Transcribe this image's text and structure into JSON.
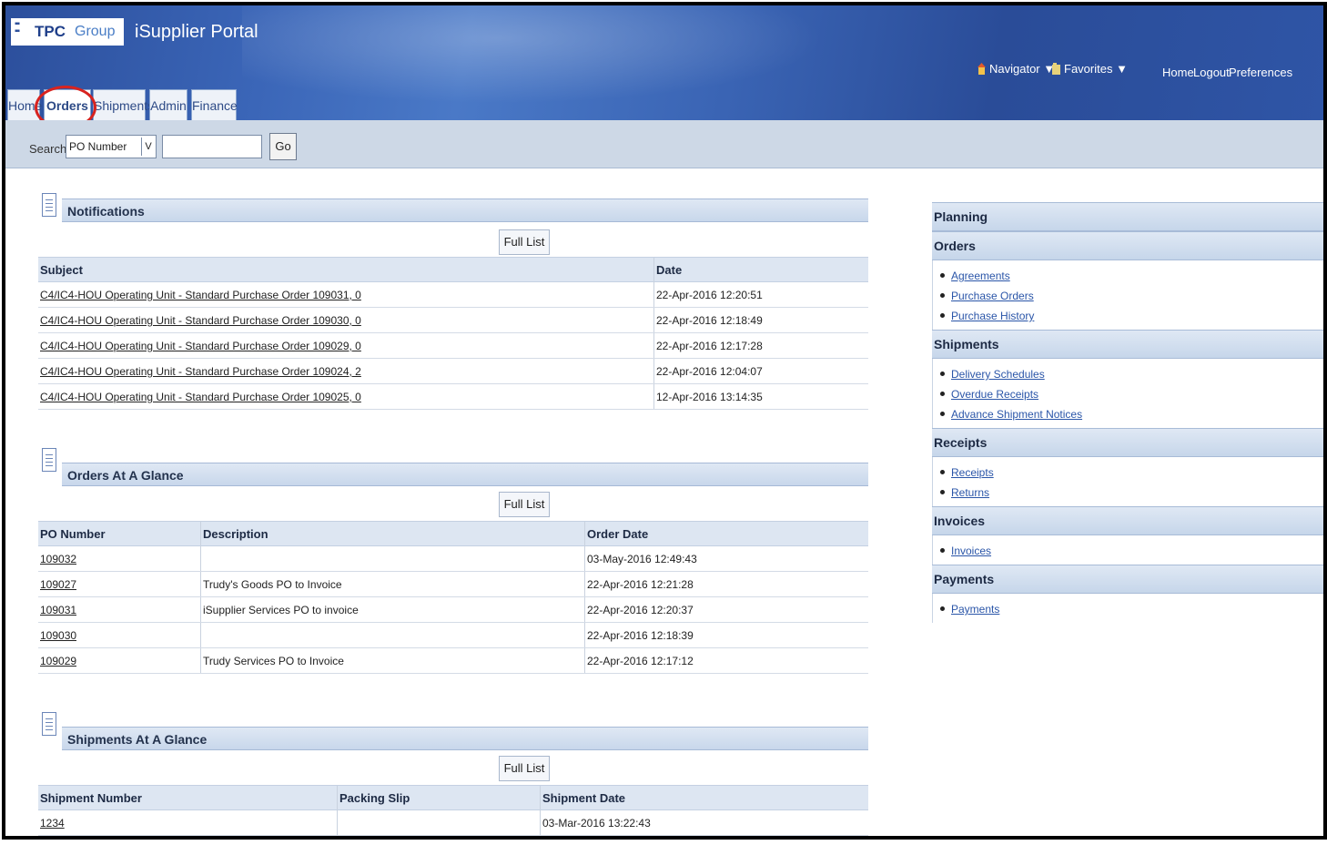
{
  "header": {
    "logo_tpc": "TPC",
    "logo_group": "Group",
    "portal_title": "iSupplier Portal",
    "navigator_label": "Navigator",
    "favorites_label": "Favorites",
    "home_label": "Home",
    "logout_label": "Logout",
    "preferences_label": "Preferences"
  },
  "tabs": [
    {
      "label": "Home"
    },
    {
      "label": "Orders",
      "selected": true
    },
    {
      "label": "Shipments"
    },
    {
      "label": "Admin"
    },
    {
      "label": "Finance"
    }
  ],
  "search": {
    "label": "Search",
    "selected_option": "PO Number",
    "value": "",
    "go_label": "Go"
  },
  "notifications": {
    "title": "Notifications",
    "full_list_label": "Full List",
    "columns": [
      "Subject",
      "Date"
    ],
    "rows": [
      {
        "subject": "C4/IC4-HOU Operating Unit - Standard Purchase Order 109031, 0",
        "date": "22-Apr-2016 12:20:51"
      },
      {
        "subject": "C4/IC4-HOU Operating Unit - Standard Purchase Order 109030, 0",
        "date": "22-Apr-2016 12:18:49"
      },
      {
        "subject": "C4/IC4-HOU Operating Unit - Standard Purchase Order 109029, 0",
        "date": "22-Apr-2016 12:17:28"
      },
      {
        "subject": "C4/IC4-HOU Operating Unit - Standard Purchase Order 109024, 2",
        "date": "22-Apr-2016 12:04:07"
      },
      {
        "subject": "C4/IC4-HOU Operating Unit - Standard Purchase Order 109025, 0",
        "date": "12-Apr-2016 13:14:35"
      }
    ]
  },
  "orders": {
    "title": "Orders At A Glance",
    "full_list_label": "Full List",
    "columns": [
      "PO Number",
      "Description",
      "Order Date"
    ],
    "rows": [
      {
        "po": "109032",
        "description": "",
        "date": "03-May-2016 12:49:43"
      },
      {
        "po": "109027",
        "description": "Trudy's Goods PO to Invoice",
        "date": "22-Apr-2016 12:21:28"
      },
      {
        "po": "109031",
        "description": "iSupplier Services PO to invoice",
        "date": "22-Apr-2016 12:20:37"
      },
      {
        "po": "109030",
        "description": "",
        "date": "22-Apr-2016 12:18:39"
      },
      {
        "po": "109029",
        "description": "Trudy Services PO to Invoice",
        "date": "22-Apr-2016 12:17:12"
      }
    ]
  },
  "shipments": {
    "title": "Shipments At A Glance",
    "full_list_label": "Full List",
    "columns": [
      "Shipment Number",
      "Packing Slip",
      "Shipment Date"
    ],
    "rows": [
      {
        "number": "1234",
        "packing_slip": "",
        "date": "03-Mar-2016 13:22:43"
      }
    ]
  },
  "sidebar": {
    "sections": [
      {
        "title": "Planning",
        "items": []
      },
      {
        "title": "Orders",
        "items": [
          "Agreements",
          "Purchase Orders",
          "Purchase History"
        ]
      },
      {
        "title": "Shipments",
        "items": [
          "Delivery Schedules",
          "Overdue Receipts",
          "Advance Shipment Notices"
        ]
      },
      {
        "title": "Receipts",
        "items": [
          "Receipts",
          "Returns"
        ]
      },
      {
        "title": "Invoices",
        "items": [
          "Invoices"
        ]
      },
      {
        "title": "Payments",
        "items": [
          "Payments"
        ]
      }
    ]
  },
  "colors": {
    "header_blue": "#2f55a6",
    "link_blue": "#2a55a8",
    "highlight_red": "#d8231f",
    "section_band": "#c8d7eb"
  }
}
